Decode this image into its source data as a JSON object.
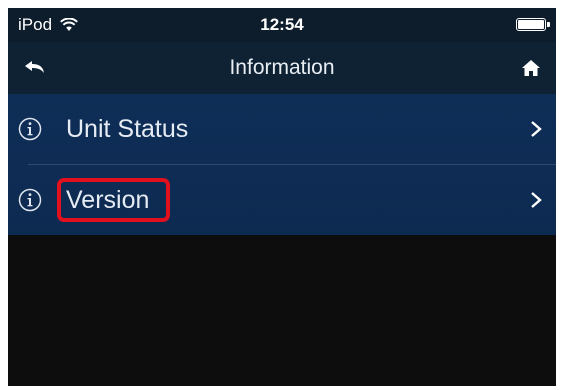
{
  "status_bar": {
    "carrier": "iPod",
    "time": "12:54",
    "wifi_icon": "wifi-icon",
    "battery_icon": "battery-icon"
  },
  "nav": {
    "title": "Information",
    "back_icon": "back-arrow-icon",
    "home_icon": "home-icon"
  },
  "list": {
    "items": [
      {
        "label": "Unit Status",
        "icon": "info-icon",
        "accessory": "chevron-right-icon"
      },
      {
        "label": "Version",
        "icon": "info-icon",
        "accessory": "chevron-right-icon",
        "highlighted": true
      }
    ]
  },
  "colors": {
    "status_bar_bg": "#0e1d2b",
    "nav_bar_bg": "#0f2233",
    "list_bg": "#0f2e57",
    "highlight": "#e0101c",
    "background": "#0d0d0d"
  }
}
